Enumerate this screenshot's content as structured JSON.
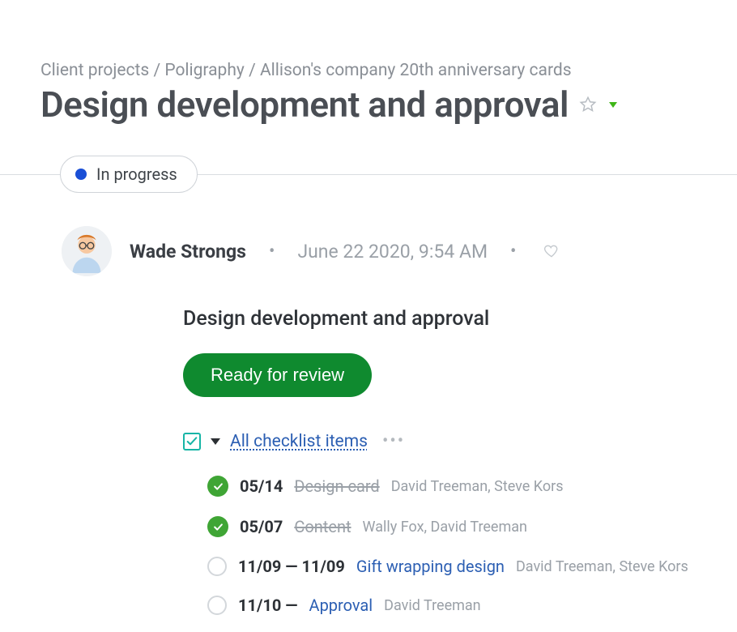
{
  "breadcrumb": {
    "part1": "Client projects",
    "part2": "Poligraphy",
    "part3": "Allison's company 20th anniversary cards"
  },
  "page_title": "Design development and approval",
  "status": {
    "label": "In progress"
  },
  "post": {
    "author": "Wade Strongs",
    "timestamp": "June 22 2020, 9:54 AM",
    "title": "Design development and approval",
    "review_button": "Ready for review"
  },
  "checklist": {
    "header_link": "All checklist items",
    "items": [
      {
        "done": true,
        "date": "05/14",
        "title": "Design card",
        "assignees": "David Treeman, Steve Kors"
      },
      {
        "done": true,
        "date": "05/07",
        "title": "Content",
        "assignees": "Wally Fox, David Treeman"
      },
      {
        "done": false,
        "date": "11/09 — 11/09",
        "title": "Gift wrapping design",
        "assignees": "David Treeman, Steve Kors"
      },
      {
        "done": false,
        "date": "11/10 —",
        "title": "Approval",
        "assignees": "David Treeman"
      }
    ]
  }
}
